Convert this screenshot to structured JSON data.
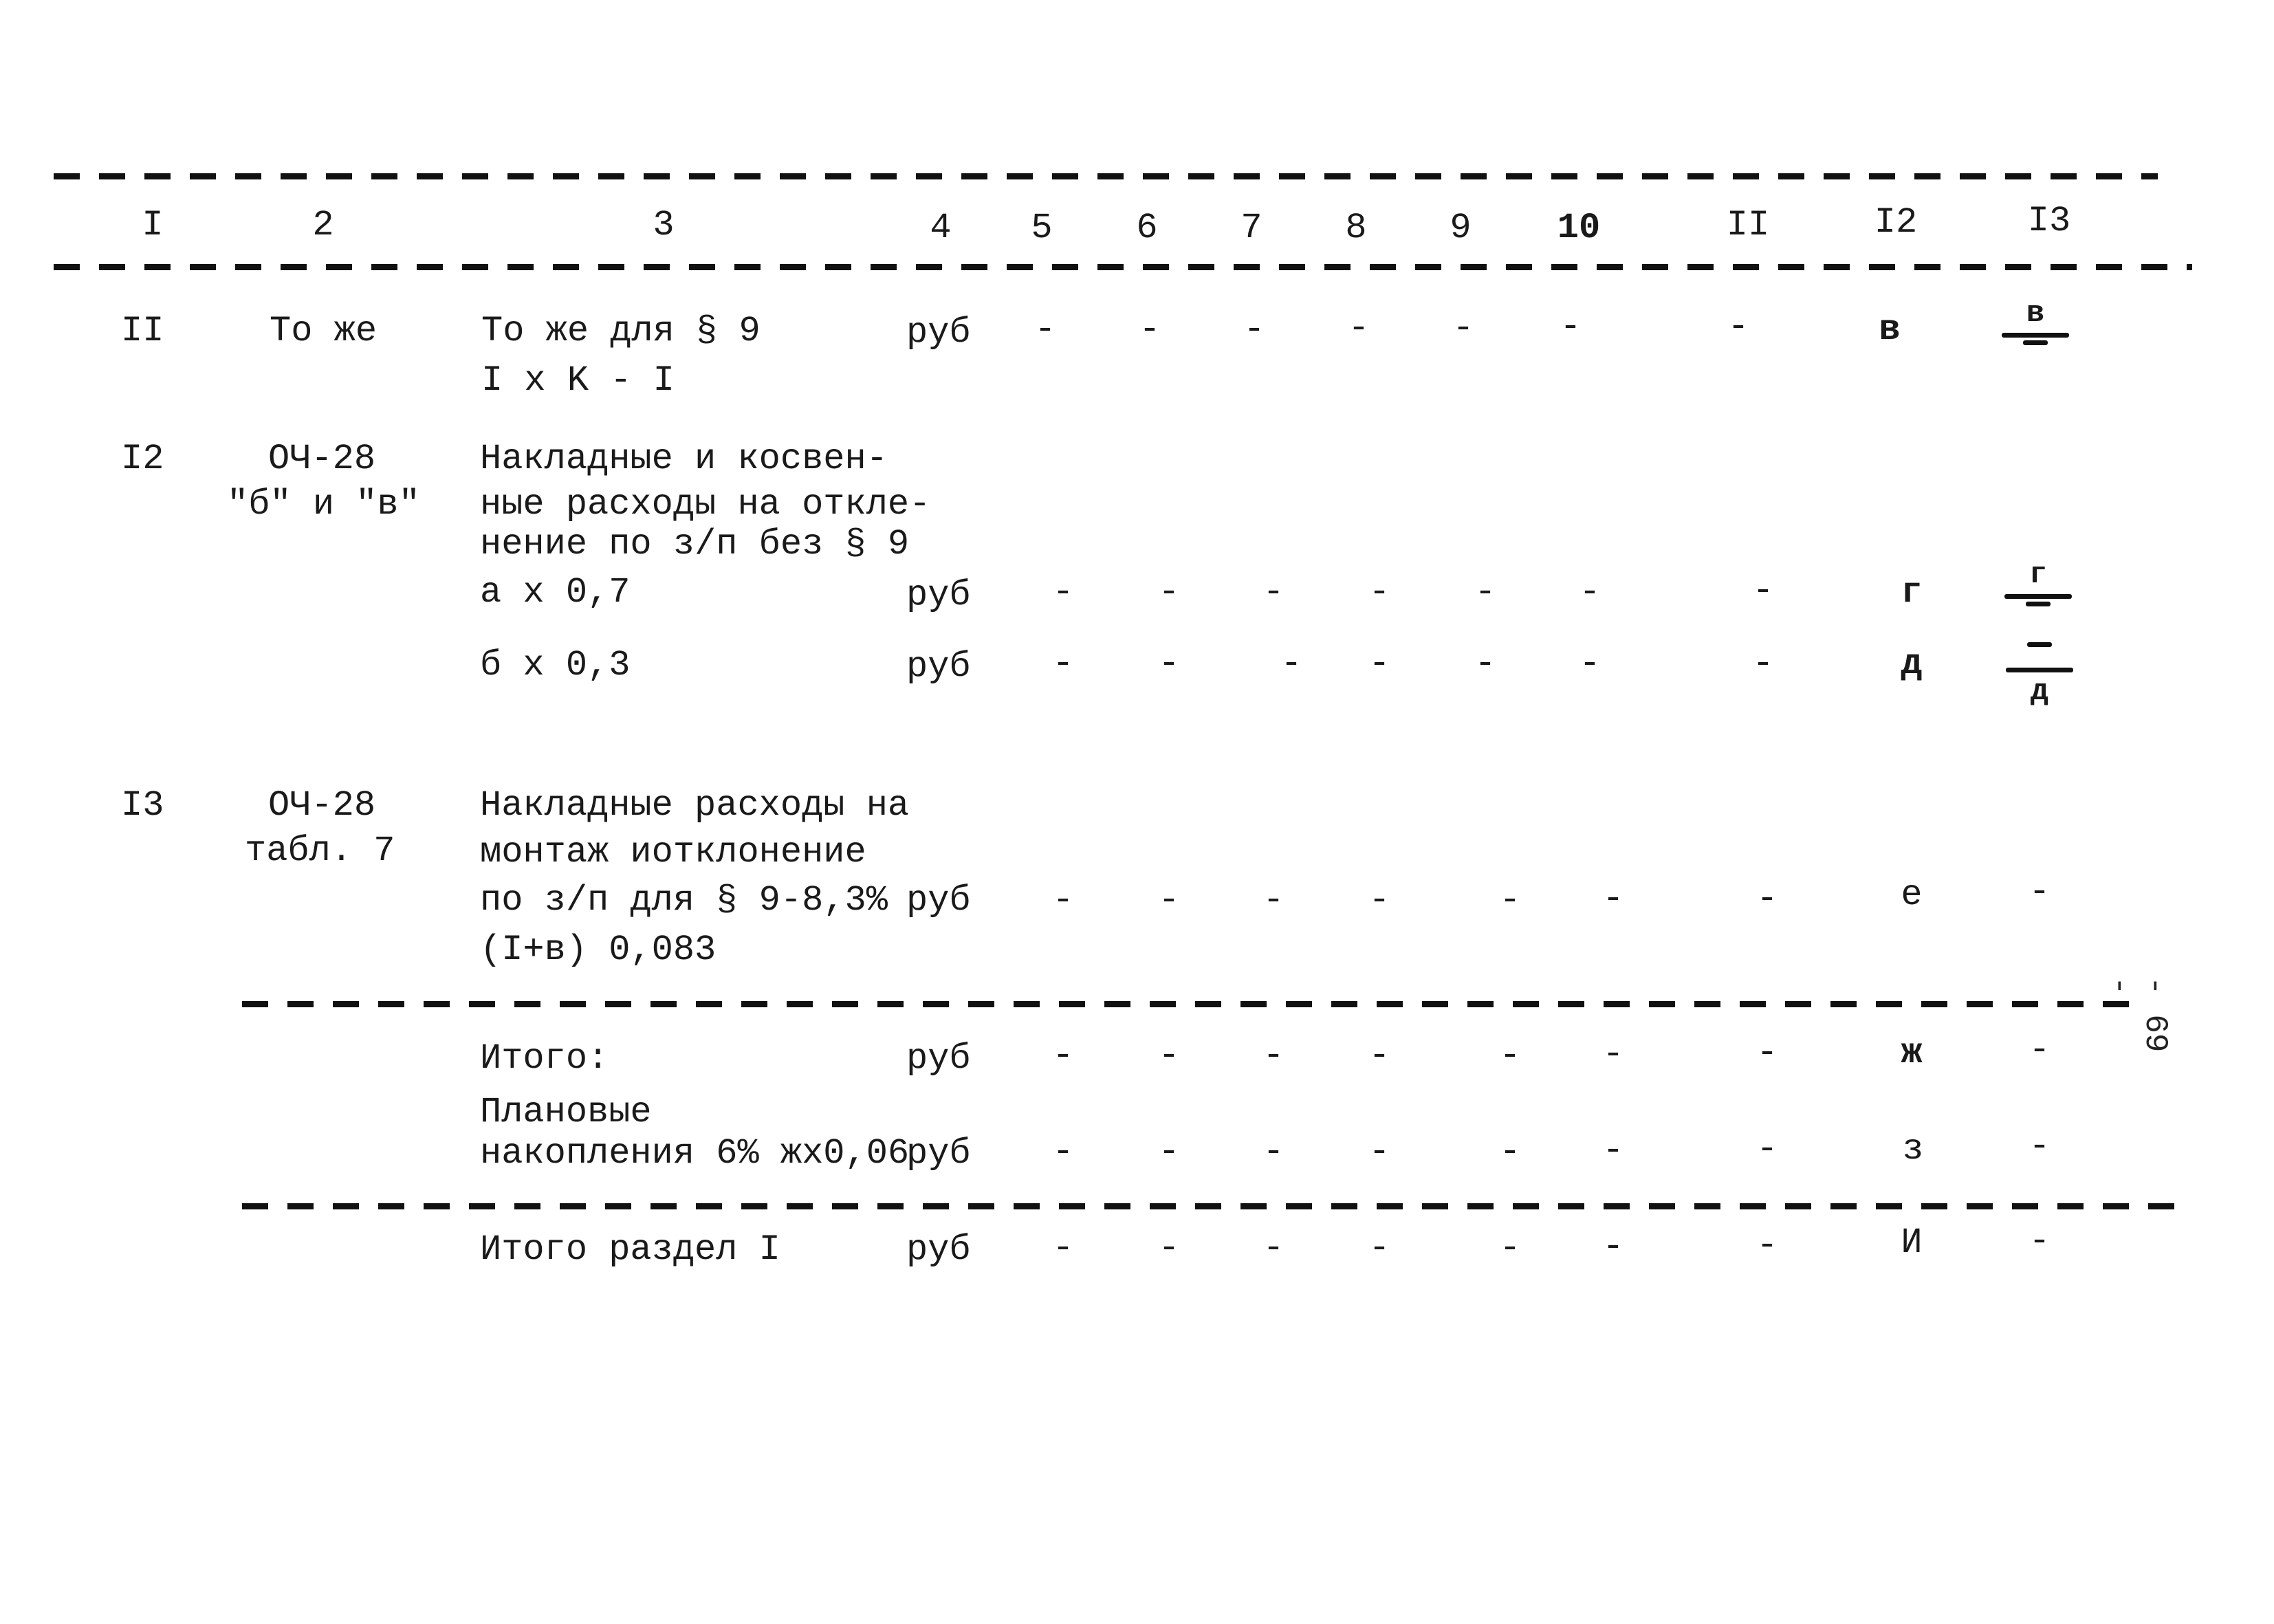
{
  "header": {
    "columns": [
      "I",
      "2",
      "3",
      "4",
      "5",
      "6",
      "7",
      "8",
      "9",
      "10",
      "II",
      "I2",
      "I3"
    ]
  },
  "rows": [
    {
      "num": "II",
      "ref": [
        "То же"
      ],
      "desc": [
        "То же для § 9",
        "I x K - I"
      ],
      "unit": "руб",
      "cols5to11": [
        "-",
        "-",
        "-",
        "-",
        "-",
        "-",
        "-"
      ],
      "col12": "в",
      "col13": {
        "numerator": "в",
        "denominator": "-"
      }
    },
    {
      "num": "I2",
      "ref": [
        "ОЧ-28",
        "\"б\" и \"в\""
      ],
      "desc": [
        "Накладные и косвен-",
        "ные расходы на откле-",
        "нение по з/п без § 9"
      ],
      "subrows": [
        {
          "desc": "а x 0,7",
          "unit": "руб",
          "cols5to11": [
            "-",
            "-",
            "-",
            "-",
            "-",
            "-",
            "-"
          ],
          "col12": "г",
          "col13": {
            "numerator": "г",
            "denominator": "-"
          }
        },
        {
          "desc": "б x 0,3",
          "unit": "руб",
          "cols5to11": [
            "-",
            "-",
            "-",
            "-",
            "-",
            "-",
            "-"
          ],
          "col12": "д",
          "col13": {
            "numerator": "-",
            "denominator": "д"
          }
        }
      ]
    },
    {
      "num": "I3",
      "ref": [
        "ОЧ-28",
        "табл. 7"
      ],
      "desc": [
        "Накладные расходы на",
        "монтаж иотклонение",
        "по з/п для § 9-8,3%",
        "(I+в) 0,083"
      ],
      "unit": "руб",
      "cols5to11": [
        "-",
        "-",
        "-",
        "-",
        "-",
        "-",
        "-"
      ],
      "col12": "е",
      "col13": "-"
    }
  ],
  "totals": [
    {
      "label": [
        "Итого:"
      ],
      "unit": "руб",
      "cols5to11": [
        "-",
        "-",
        "-",
        "-",
        "-",
        "-",
        "-"
      ],
      "col12": "ж",
      "col13": "-"
    },
    {
      "label": [
        "Плановые",
        "накопления 6% жx0,06"
      ],
      "unit": "руб",
      "cols5to11": [
        "-",
        "-",
        "-",
        "-",
        "-",
        "-",
        "-"
      ],
      "col12": "з",
      "col13": "-"
    }
  ],
  "section_total": {
    "label": "Итого раздел I",
    "unit": "руб",
    "cols5to11": [
      "-",
      "-",
      "-",
      "-",
      "-",
      "-",
      "-"
    ],
    "col12": "И",
    "col13": "-"
  },
  "margin_mark": "- 69 -"
}
